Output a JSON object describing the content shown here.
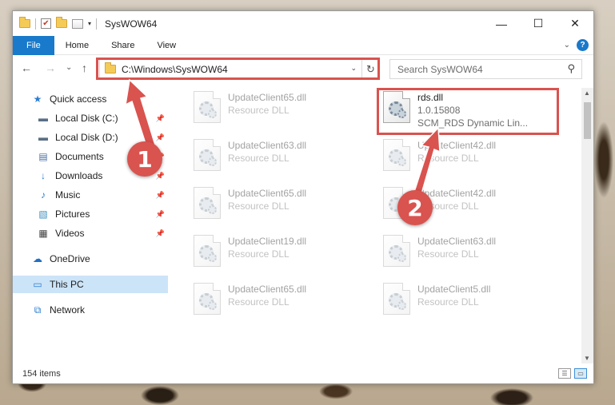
{
  "window": {
    "title": "SysWOW64",
    "controls": {
      "minimize": "—",
      "maximize": "☐",
      "close": "✕"
    }
  },
  "quick_access_toolbar": {
    "dropdown": "▾"
  },
  "ribbon": {
    "tabs": [
      {
        "label": "File"
      },
      {
        "label": "Home"
      },
      {
        "label": "Share"
      },
      {
        "label": "View"
      }
    ],
    "expand_icon": "⌄",
    "help_label": "?"
  },
  "navbar": {
    "back": "←",
    "forward": "→",
    "recent": "⌄",
    "up": "↑",
    "address": "C:\\Windows\\SysWOW64",
    "address_dropdown": "⌄",
    "refresh": "↻",
    "search_placeholder": "Search SysWOW64",
    "search_icon": "⚲"
  },
  "sidebar": {
    "items": [
      {
        "label": "Quick access",
        "icon": "star-icon",
        "glyph": "★",
        "color": "#2b7cd3",
        "pinned": false
      },
      {
        "label": "Local Disk (C:)",
        "icon": "drive-icon",
        "glyph": "▬",
        "color": "#5a6f86",
        "pinned": true
      },
      {
        "label": "Local Disk (D:)",
        "icon": "drive-icon",
        "glyph": "▬",
        "color": "#5a6f86",
        "pinned": true
      },
      {
        "label": "Documents",
        "icon": "documents-icon",
        "glyph": "▤",
        "color": "#4a6fa5",
        "pinned": true
      },
      {
        "label": "Downloads",
        "icon": "download-icon",
        "glyph": "↓",
        "color": "#2b7cd3",
        "pinned": true
      },
      {
        "label": "Music",
        "icon": "music-icon",
        "glyph": "♪",
        "color": "#2b7cd3",
        "pinned": true
      },
      {
        "label": "Pictures",
        "icon": "pictures-icon",
        "glyph": "▧",
        "color": "#3f8fbf",
        "pinned": true
      },
      {
        "label": "Videos",
        "icon": "videos-icon",
        "glyph": "▦",
        "color": "#444",
        "pinned": true
      },
      {
        "label": "OneDrive",
        "icon": "cloud-icon",
        "glyph": "☁",
        "color": "#1f6fc5",
        "pinned": false
      },
      {
        "label": "This PC",
        "icon": "computer-icon",
        "glyph": "▭",
        "color": "#2b7cd3",
        "pinned": false,
        "selected": true
      },
      {
        "label": "Network",
        "icon": "network-icon",
        "glyph": "⧉",
        "color": "#2b7cd3",
        "pinned": false
      }
    ],
    "pin_glyph": "📌"
  },
  "files": [
    {
      "name": "UpdateClient65.dll",
      "sub": "Resource DLL",
      "faded": true
    },
    {
      "name": "rds.dll",
      "version": "1.0.15808",
      "sub": "SCM_RDS Dynamic Lin...",
      "faded": false,
      "highlighted": true
    },
    {
      "name": "UpdateClient63.dll",
      "sub": "Resource DLL",
      "faded": true
    },
    {
      "name": "UpdateClient42.dll",
      "sub": "Resource DLL",
      "faded": true
    },
    {
      "name": "UpdateClient65.dll",
      "sub": "Resource DLL",
      "faded": true
    },
    {
      "name": "UpdateClient42.dll",
      "sub": "Resource DLL",
      "faded": true
    },
    {
      "name": "UpdateClient19.dll",
      "sub": "Resource DLL",
      "faded": true
    },
    {
      "name": "UpdateClient63.dll",
      "sub": "Resource DLL",
      "faded": true
    },
    {
      "name": "UpdateClient65.dll",
      "sub": "Resource DLL",
      "faded": true
    },
    {
      "name": "UpdateClient5.dll",
      "sub": "Resource DLL",
      "faded": true
    }
  ],
  "statusbar": {
    "item_count": "154 items"
  },
  "callouts": [
    {
      "label": "1"
    },
    {
      "label": "2"
    }
  ],
  "colors": {
    "accent": "#1979ca",
    "highlight": "#d9534f",
    "selected": "#cce4f7"
  }
}
